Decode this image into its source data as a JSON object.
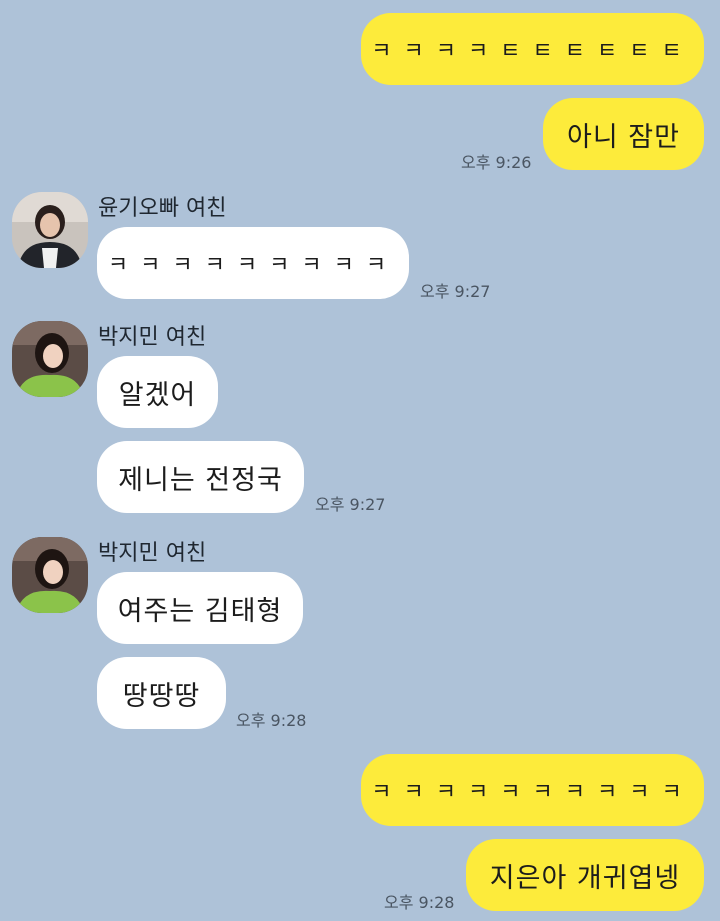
{
  "colors": {
    "background": "#aec2d8",
    "my_bubble": "#fdeb3b",
    "their_bubble": "#ffffff"
  },
  "messages": {
    "m1": "ㅋㅋㅋㅋㅌㅌㅌㅌㅌㅌ",
    "m2": "아니 잠만",
    "t1": "오후 9:26",
    "sender1": "윤기오빠 여친",
    "m3": "ㅋㅋㅋㅋㅋㅋㅋㅋㅋ",
    "t2": "오후 9:27",
    "sender2": "박지민 여친",
    "m4": "알겠어",
    "m5": "제니는 전정국",
    "t3": "오후 9:27",
    "sender3": "박지민 여친",
    "m6": "여주는 김태형",
    "m7": "땅땅땅",
    "t4": "오후 9:28",
    "m8": "ㅋㅋㅋㅋㅋㅋㅋㅋㅋㅋ",
    "m9": "지은아 개귀엽넹",
    "t5": "오후 9:28"
  }
}
